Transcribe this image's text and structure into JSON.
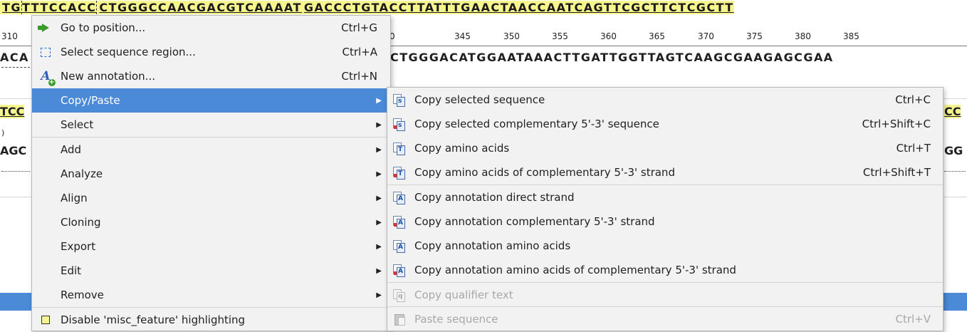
{
  "sequence": {
    "top_left": "TG",
    "top_selected": "TTTCCACC",
    "top_hidden": "CTGGGCCAACGACGTCAAAAT",
    "top_right": "GACCCTGTACCTTATTTGAACTAACCAATCAGTTCGCTTCTCGCTT",
    "ruler_left": "310",
    "ruler_ticks": [
      "0",
      "345",
      "350",
      "355",
      "360",
      "365",
      "370",
      "375",
      "380",
      "385"
    ],
    "comp_left": "ACA",
    "comp_right": "CTGGGACATGGAATAAACTTGATTGGTTAGTCAAGCGAAGAGCGAA",
    "row2_left": "TCC",
    "row2_right": "CC",
    "row2_paren": ")",
    "row3_left": "AGC",
    "row3_right": "GG"
  },
  "main_menu": {
    "items": [
      {
        "label": "Go to position...",
        "shortcut": "Ctrl+G",
        "icon": "go-arrow-icon"
      },
      {
        "label": "Select sequence region...",
        "shortcut": "Ctrl+A",
        "icon": "select-region-icon"
      },
      {
        "label": "New annotation...",
        "shortcut": "Ctrl+N",
        "icon": "new-annotation-icon"
      },
      {
        "label": "Copy/Paste",
        "submenu": true
      },
      {
        "label": "Select",
        "submenu": true
      },
      {
        "label": "Add",
        "submenu": true
      },
      {
        "label": "Analyze",
        "submenu": true
      },
      {
        "label": "Align",
        "submenu": true
      },
      {
        "label": "Cloning",
        "submenu": true
      },
      {
        "label": "Export",
        "submenu": true
      },
      {
        "label": "Edit",
        "submenu": true
      },
      {
        "label": "Remove",
        "submenu": true
      },
      {
        "label": "Disable 'misc_feature' highlighting",
        "icon": "highlight-checkbox-icon"
      }
    ]
  },
  "sub_menu": {
    "items": [
      {
        "label": "Copy selected sequence",
        "shortcut": "Ctrl+C",
        "icon_tag": "s"
      },
      {
        "label": "Copy selected complementary 5'-3' sequence",
        "shortcut": "Ctrl+Shift+C",
        "icon_tag": "s"
      },
      {
        "label": "Copy amino acids",
        "shortcut": "Ctrl+T",
        "icon_tag": "T"
      },
      {
        "label": "Copy amino acids of complementary 5'-3' strand",
        "shortcut": "Ctrl+Shift+T",
        "icon_tag": "T"
      },
      {
        "label": "Copy annotation direct strand",
        "shortcut": "",
        "icon_tag": "A"
      },
      {
        "label": "Copy annotation complementary 5'-3' strand",
        "shortcut": "",
        "icon_tag": "A"
      },
      {
        "label": "Copy annotation amino acids",
        "shortcut": "",
        "icon_tag": "A"
      },
      {
        "label": "Copy annotation amino acids of complementary 5'-3' strand",
        "shortcut": "",
        "icon_tag": "A"
      },
      {
        "label": "Copy qualifier text",
        "shortcut": "",
        "icon_tag": "q",
        "disabled": true
      },
      {
        "label": "Paste sequence",
        "shortcut": "Ctrl+V",
        "disabled": true
      }
    ]
  },
  "colors": {
    "selection_blue": "#4a8ad6",
    "highlight_yellow": "#f6f58e",
    "menu_bg": "#f2f2f2",
    "disabled_text": "#a8a8a8"
  }
}
